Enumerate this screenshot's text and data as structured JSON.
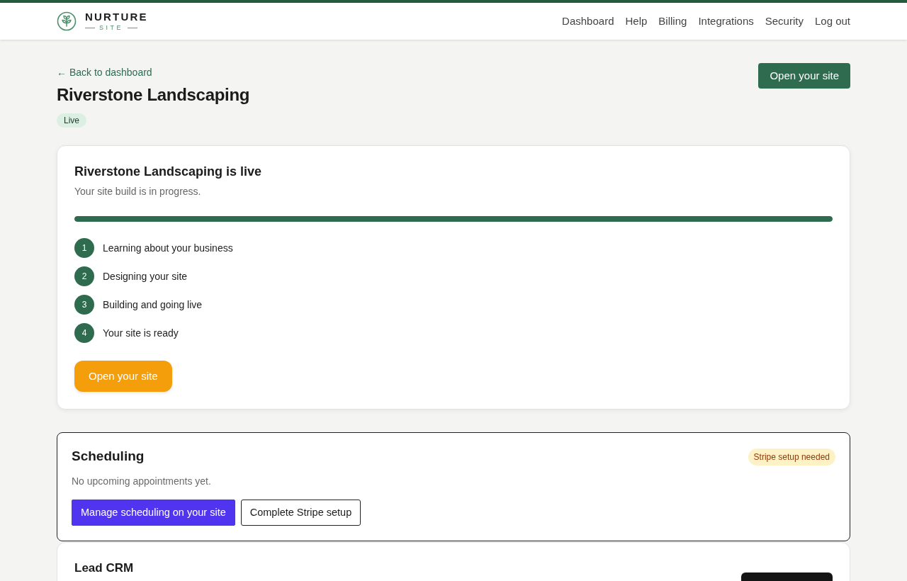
{
  "header": {
    "logo": {
      "name": "NURTURE",
      "tagline": "SITE"
    },
    "nav": [
      {
        "label": "Dashboard"
      },
      {
        "label": "Help"
      },
      {
        "label": "Billing"
      },
      {
        "label": "Integrations"
      },
      {
        "label": "Security"
      },
      {
        "label": "Log out"
      }
    ]
  },
  "page": {
    "back_link": "← Back to dashboard",
    "title": "Riverstone Landscaping",
    "status": "Live",
    "open_button": "Open your site"
  },
  "progress_card": {
    "title": "Riverstone Landscaping is live",
    "subtitle": "Your site build is in progress.",
    "progress": {
      "level": 1
    },
    "steps": [
      {
        "number": "1",
        "label": "Learning about your business"
      },
      {
        "number": "2",
        "label": "Designing your site"
      },
      {
        "number": "3",
        "label": "Building and going live"
      },
      {
        "number": "4",
        "label": "Your site is ready"
      }
    ],
    "button": "Open your site"
  },
  "scheduling_card": {
    "title": "Scheduling",
    "badge": "Stripe setup needed",
    "message": "No upcoming appointments yet.",
    "buttons": [
      {
        "label": "Manage scheduling on your site",
        "kind": "primary"
      },
      {
        "label": "Complete Stripe setup",
        "kind": "outline"
      }
    ]
  },
  "lead_crm_card": {
    "title": "Lead CRM"
  }
}
